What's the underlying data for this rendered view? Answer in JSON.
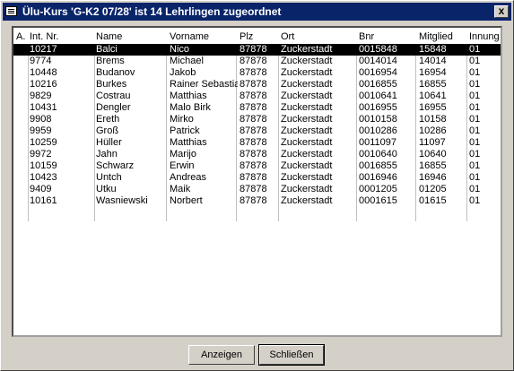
{
  "window": {
    "title": "Ülu-Kurs 'G-K2 07/28' ist 14 Lehrlingen zugeordnet",
    "close_label": "x"
  },
  "table": {
    "columns": [
      "A.",
      "Int. Nr.",
      "Name",
      "Vorname",
      "Plz",
      "Ort",
      "Bnr",
      "Mitglied",
      "Innung"
    ],
    "rows": [
      [
        "",
        "10217",
        "Balci",
        "Nico",
        "87878",
        "Zuckerstadt",
        "0015848",
        "15848",
        "01"
      ],
      [
        "",
        "9774",
        "Brems",
        "Michael",
        "87878",
        "Zuckerstadt",
        "0014014",
        "14014",
        "01"
      ],
      [
        "",
        "10448",
        "Budanov",
        "Jakob",
        "87878",
        "Zuckerstadt",
        "0016954",
        "16954",
        "01"
      ],
      [
        "",
        "10216",
        "Burkes",
        "Rainer Sebastian",
        "87878",
        "Zuckerstadt",
        "0016855",
        "16855",
        "01"
      ],
      [
        "",
        "9829",
        "Costrau",
        "Matthias",
        "87878",
        "Zuckerstadt",
        "0010641",
        "10641",
        "01"
      ],
      [
        "",
        "10431",
        "Dengler",
        "Malo Birk",
        "87878",
        "Zuckerstadt",
        "0016955",
        "16955",
        "01"
      ],
      [
        "",
        "9908",
        "Ereth",
        "Mirko",
        "87878",
        "Zuckerstadt",
        "0010158",
        "10158",
        "01"
      ],
      [
        "",
        "9959",
        "Groß",
        "Patrick",
        "87878",
        "Zuckerstadt",
        "0010286",
        "10286",
        "01"
      ],
      [
        "",
        "10259",
        "Hüller",
        "Matthias",
        "87878",
        "Zuckerstadt",
        "0011097",
        "11097",
        "01"
      ],
      [
        "",
        "9972",
        "Jahn",
        "Marijo",
        "87878",
        "Zuckerstadt",
        "0010640",
        "10640",
        "01"
      ],
      [
        "",
        "10159",
        "Schwarz",
        "Erwin",
        "87878",
        "Zuckerstadt",
        "0016855",
        "16855",
        "01"
      ],
      [
        "",
        "10423",
        "Untch",
        "Andreas",
        "87878",
        "Zuckerstadt",
        "0016946",
        "16946",
        "01"
      ],
      [
        "",
        "9409",
        "Utku",
        "Maik",
        "87878",
        "Zuckerstadt",
        "0001205",
        "01205",
        "01"
      ],
      [
        "",
        "10161",
        "Wasniewski",
        "Norbert",
        "87878",
        "Zuckerstadt",
        "0001615",
        "01615",
        "01"
      ]
    ],
    "selected_index": 0
  },
  "buttons": {
    "show_label": "Anzeigen",
    "close_label": "Schließen"
  },
  "colors": {
    "titlebar": "#0a246a",
    "face": "#d4d0c8",
    "selection": "#000000"
  }
}
